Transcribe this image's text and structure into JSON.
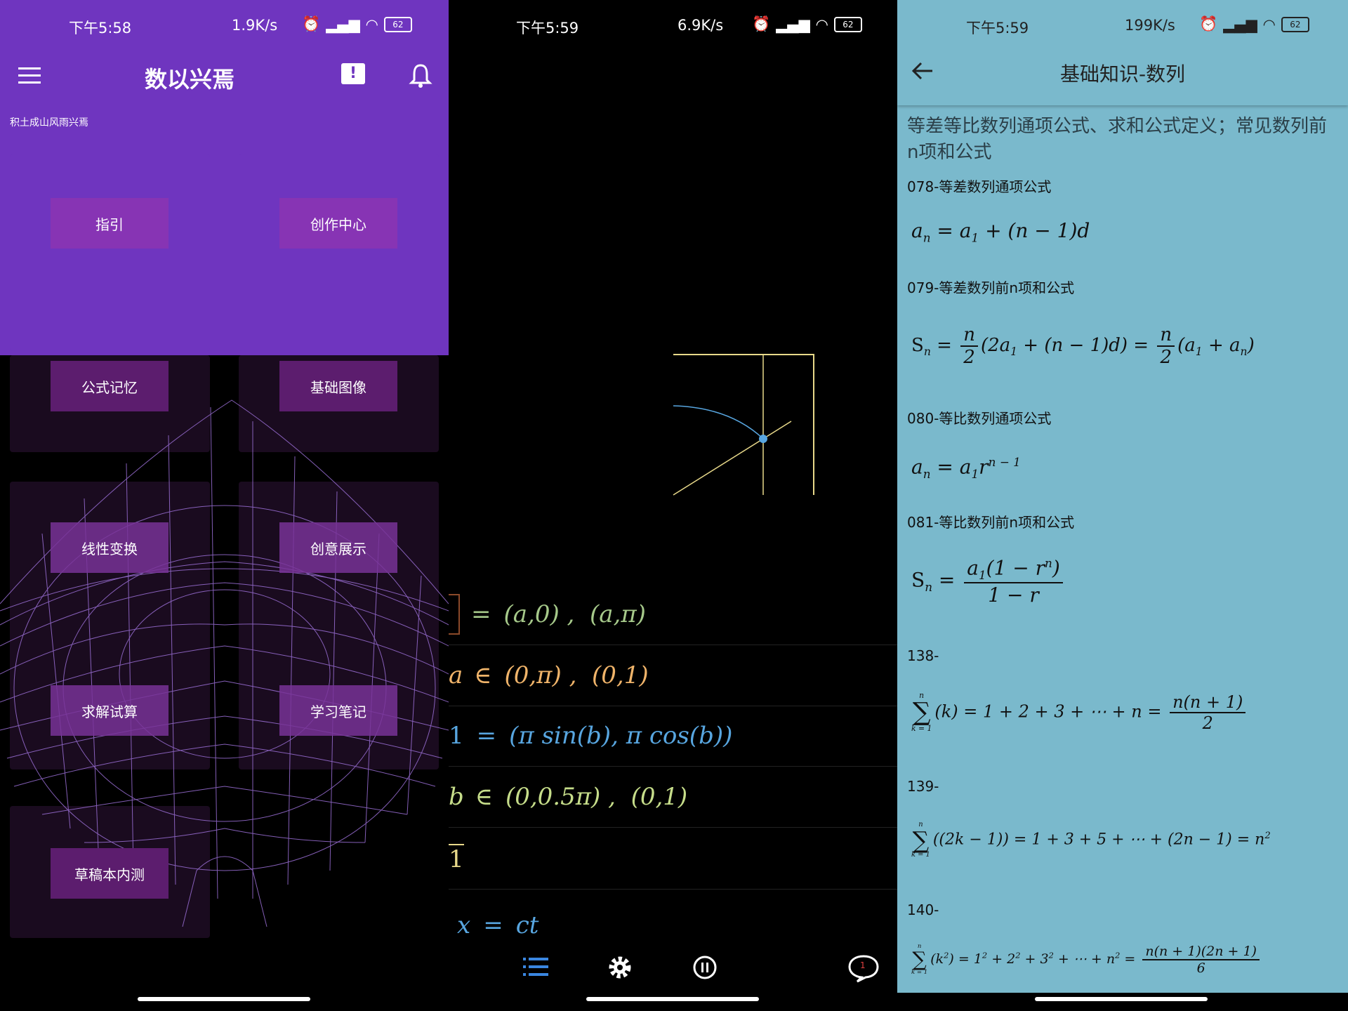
{
  "panel1": {
    "status": {
      "time": "下午5:58",
      "rate": "1.9K/s",
      "battery": "62"
    },
    "app_title": "数以兴焉",
    "subtitle": "积土成山风雨兴焉",
    "buttons": [
      "指引",
      "创作中心",
      "公式记忆",
      "基础图像",
      "线性变换",
      "创意展示",
      "求解试算",
      "学习笔记",
      "草稿本内测"
    ],
    "icons": [
      "menu-icon",
      "feedback-icon",
      "bell-icon",
      "wireframe-surface"
    ]
  },
  "panel2": {
    "status": {
      "time": "下午5:59",
      "rate": "6.9K/s",
      "battery": "62"
    },
    "eq1": {
      "lhs": "=",
      "a": "(a,0)",
      "sep": " ,  ",
      "b": "(a,π)"
    },
    "eq2": {
      "lhs": "a",
      "op": "∈",
      "a": "(0,π)",
      "sep": " ,  ",
      "b": "(0,1)"
    },
    "eq3": {
      "lhs": "1",
      "op": "=",
      "a": "(π sin(b), π cos(b))"
    },
    "eq4": {
      "lhs": "b",
      "op": "∈",
      "a": "(0,0.5π)",
      "sep": " ,  ",
      "b": "(0,1)"
    },
    "eq5": {
      "lhs": "1"
    },
    "eq6": {
      "lhs": "x",
      "op": "=",
      "a": "ct"
    },
    "comment_badge": "1",
    "colors": {
      "green": "#a6c98a",
      "orange": "#f0b46a",
      "blue": "#58a6e0",
      "yellow": "#e8d98a"
    }
  },
  "panel3": {
    "status": {
      "time": "下午5:59",
      "rate": "199K/s",
      "battery": "62"
    },
    "title": "基础知识-数列",
    "description": "等差等比数列通项公式、求和公式定义；常见数列前n项和公式",
    "sections": [
      "078-等差数列通项公式",
      "079-等差数列前n项和公式",
      "080-等比数列通项公式",
      "081-等比数列前n项和公式",
      "138-",
      "139-",
      "140-"
    ]
  }
}
